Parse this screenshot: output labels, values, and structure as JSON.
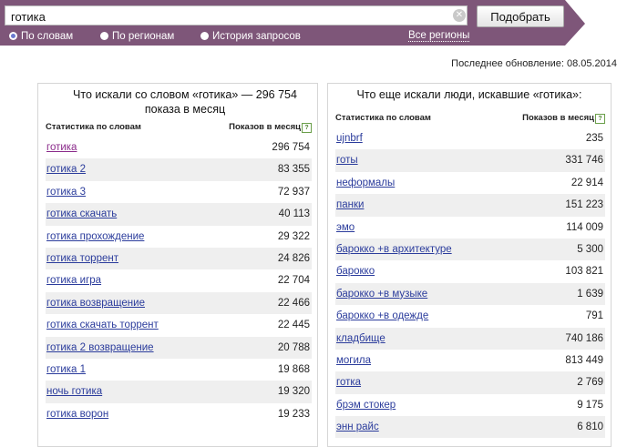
{
  "colors": {
    "bar": "#7e5679",
    "link": "#2b3c9c",
    "visited_link": "#8a2a8a",
    "row_alt": "#efefef"
  },
  "search": {
    "query": "готика",
    "submit_label": "Подобрать"
  },
  "modes": [
    {
      "label": "По словам",
      "checked": true
    },
    {
      "label": "По регионам",
      "checked": false
    },
    {
      "label": "История запросов",
      "checked": false
    }
  ],
  "regions_link": "Все регионы",
  "last_update": "Последнее обновление: 08.05.2014",
  "left_panel": {
    "title": "Что искали со словом «готика» — 296 754 показа в месяц",
    "col_phrase": "Статистика по словам",
    "col_shows": "Показов в месяц",
    "help": "?",
    "rows": [
      {
        "phrase": "готика",
        "count": "296 754"
      },
      {
        "phrase": "готика 2",
        "count": "83 355"
      },
      {
        "phrase": "готика 3",
        "count": "72 937"
      },
      {
        "phrase": "готика скачать",
        "count": "40 113"
      },
      {
        "phrase": "готика прохождение",
        "count": "29 322"
      },
      {
        "phrase": "готика торрент",
        "count": "24 826"
      },
      {
        "phrase": "готика игра",
        "count": "22 704"
      },
      {
        "phrase": "готика возвращение",
        "count": "22 466"
      },
      {
        "phrase": "готика скачать торрент",
        "count": "22 445"
      },
      {
        "phrase": "готика 2 возвращение",
        "count": "20 788"
      },
      {
        "phrase": "готика 1",
        "count": "19 868"
      },
      {
        "phrase": "ночь готика",
        "count": "19 320"
      },
      {
        "phrase": "готика ворон",
        "count": "19 233"
      }
    ]
  },
  "right_panel": {
    "title": "Что еще искали люди, искавшие «готика»:",
    "col_phrase": "Статистика по словам",
    "col_shows": "Показов в месяц",
    "help": "?",
    "rows": [
      {
        "phrase": "ujnbrf",
        "count": "235"
      },
      {
        "phrase": "готы",
        "count": "331 746"
      },
      {
        "phrase": "неформалы",
        "count": "22 914"
      },
      {
        "phrase": "панки",
        "count": "151 223"
      },
      {
        "phrase": "эмо",
        "count": "114 009"
      },
      {
        "phrase": "барокко +в архитектуре",
        "count": "5 300"
      },
      {
        "phrase": "барокко",
        "count": "103 821"
      },
      {
        "phrase": "барокко +в музыке",
        "count": "1 639"
      },
      {
        "phrase": "барокко +в одежде",
        "count": "791"
      },
      {
        "phrase": "кладбище",
        "count": "740 186"
      },
      {
        "phrase": "могила",
        "count": "813 449"
      },
      {
        "phrase": "готка",
        "count": "2 769"
      },
      {
        "phrase": "брэм стокер",
        "count": "9 175"
      },
      {
        "phrase": "энн райс",
        "count": "6 810"
      }
    ]
  }
}
